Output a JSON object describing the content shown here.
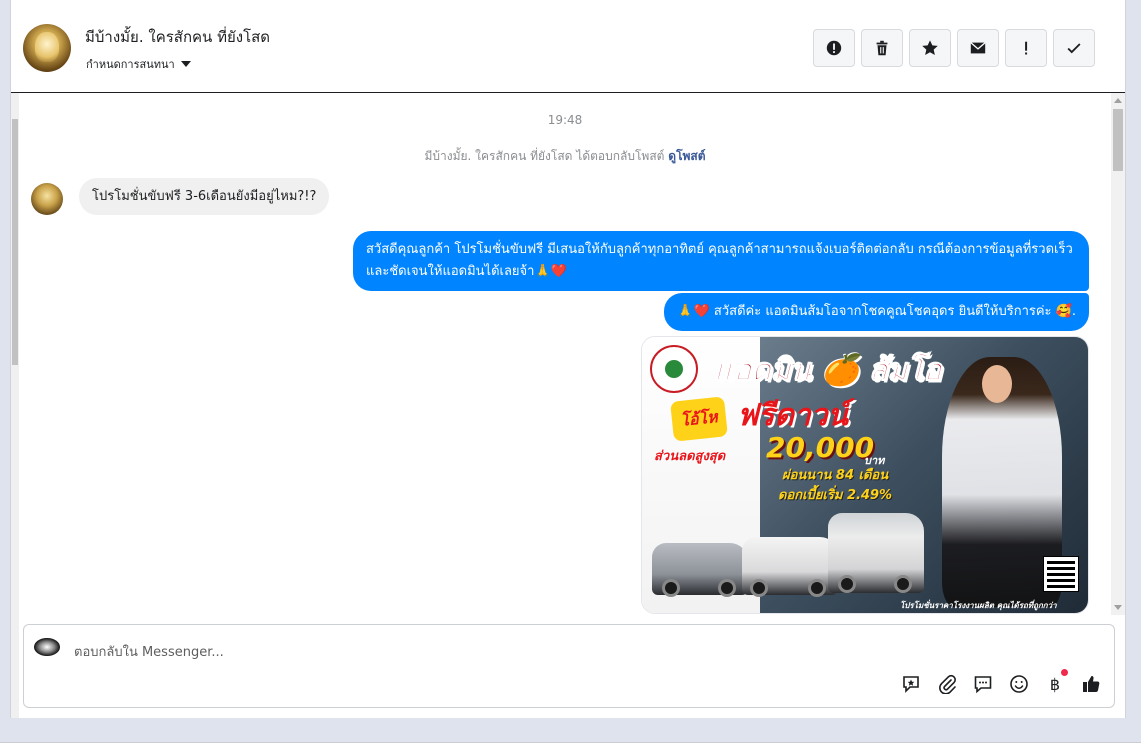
{
  "header": {
    "title": "มีบ้างมั้ย. ใครสักคน ที่ยังโสด",
    "subtitle": "กำหนดการสนทนา",
    "actions": [
      "report-icon",
      "trash-icon",
      "star-icon",
      "mail-icon",
      "exclamation-icon",
      "check-icon"
    ]
  },
  "thread": {
    "timestamp": "19:48",
    "system_message": "มีบ้างมั้ย. ใครสักคน ที่ยังโสด ได้ตอบกลับโพสต์",
    "system_link": "ดูโพสต์",
    "incoming": [
      {
        "text": "โปรโมชั่นขับฟรี 3-6เดือนยังมีอยู่ไหม?!?"
      }
    ],
    "outgoing": [
      {
        "text": "สวัสดีคุณลูกค้า โปรโมชั่นขับฟรี มีเสนอให้กับลูกค้าทุกอาทิตย์ คุณลูกค้าสามารถแจ้งเบอร์ติดต่อกลับ กรณีต้องการข้อมูลที่รวดเร็วและชัดเจนให้แอดมินได้เลยจ้า🙏❤️"
      },
      {
        "text": "🙏❤️ สวัสดีค่ะ แอดมินส้มโอจากโชคคูณโชคอุดร ยินดีให้บริการค่ะ 🥰."
      }
    ],
    "promo_image": {
      "title": "แอดมิน 🍊 ส้มโอ",
      "badge": "โอ้โห",
      "headline": "ฟรีดาวน์",
      "discount_label": "ส่วนลดสูงสุด",
      "amount": "20,000",
      "currency": "บาท",
      "installment": "ผ่อนนาน 84 เดือน",
      "interest": "ดอกเบี้ยเริ่ม 2.49%",
      "footer": "โปรโมชั่นราคาโรงงานผลิต คุณได้รถที่ถูกกว่า"
    }
  },
  "composer": {
    "placeholder": "ตอบกลับใน Messenger...",
    "tools": [
      "sticker-icon",
      "attach-icon",
      "quick-reply-icon",
      "emoji-icon",
      "payment-icon",
      "like-icon"
    ],
    "payment_symbol": "฿"
  },
  "colors": {
    "outgoing_bubble": "#0084ff",
    "incoming_bubble": "#f0f0f0",
    "link": "#385898"
  }
}
